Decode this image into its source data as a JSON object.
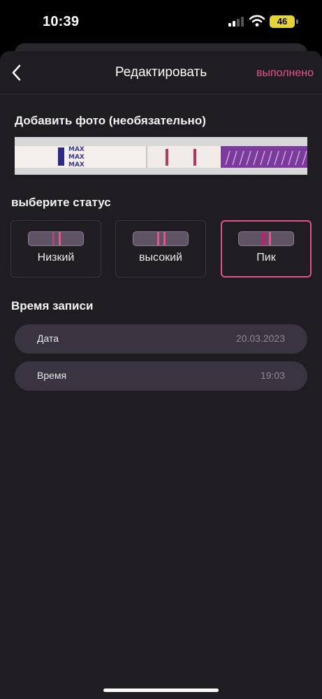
{
  "status_bar": {
    "time": "10:39",
    "battery": "46",
    "battery_color": "#e5d33a"
  },
  "nav": {
    "back_icon": "chevron-left-icon",
    "title": "Редактировать",
    "done_label": "выполнено"
  },
  "photo_section": {
    "title": "Добавить фото (необязательно)",
    "strip_text": [
      "MAX",
      "MAX",
      "MAX"
    ]
  },
  "status_section": {
    "title": "выберите статус",
    "options": [
      {
        "label": "Низкий",
        "selected": false
      },
      {
        "label": "высокий",
        "selected": false
      },
      {
        "label": "Пик",
        "selected": true
      }
    ]
  },
  "record_time": {
    "title": "Время записи",
    "date_label": "Дата",
    "date_value": "20.03.2023",
    "time_label": "Время",
    "time_value": "19:03"
  },
  "colors": {
    "accent": "#e8528d",
    "background": "#201d22",
    "row_background": "#3a3440"
  }
}
